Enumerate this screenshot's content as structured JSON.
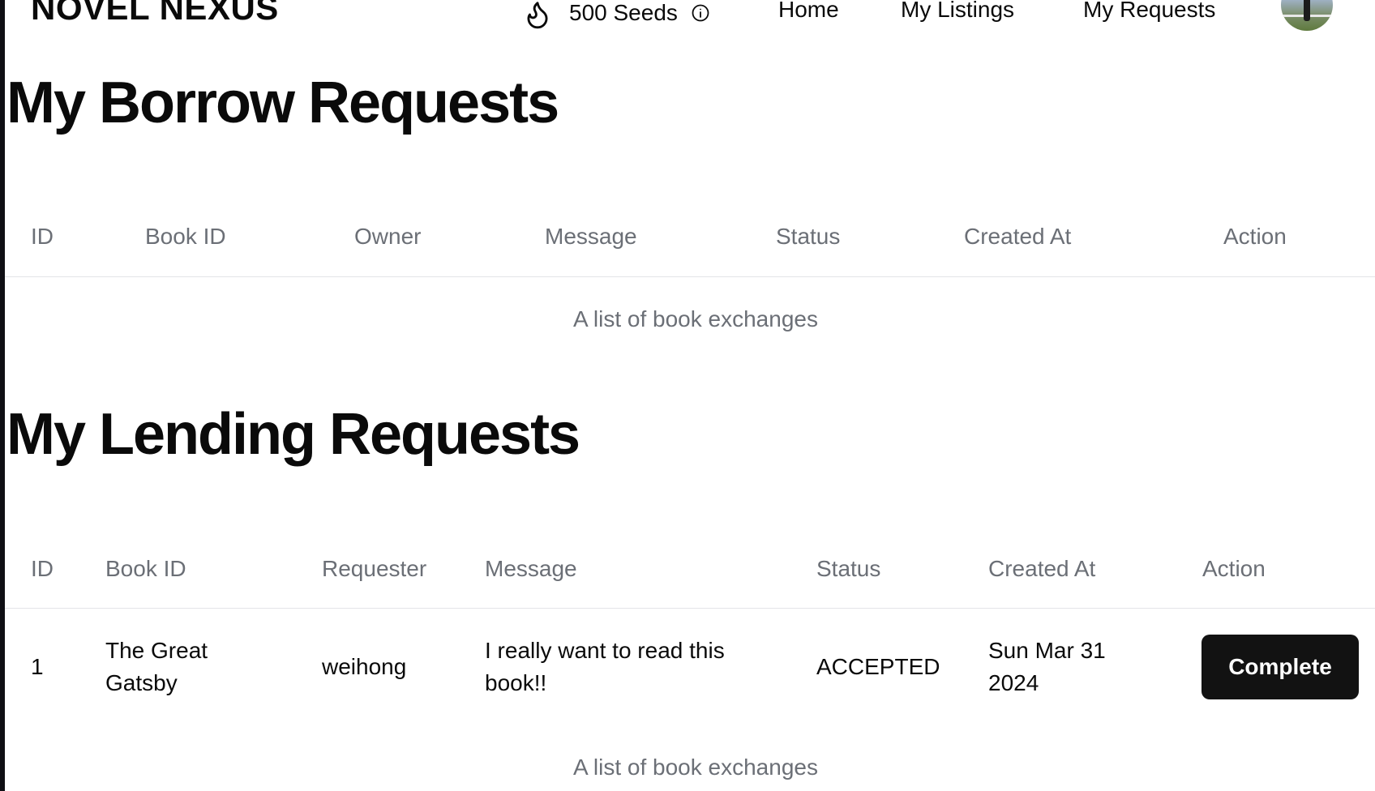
{
  "header": {
    "brand": "NOVEL NEXUS",
    "seeds_label": "500 Seeds",
    "nav": {
      "home": "Home",
      "my_listings": "My Listings",
      "my_requests": "My Requests"
    }
  },
  "borrow": {
    "title": "My Borrow Requests",
    "columns": {
      "id": "ID",
      "book_id": "Book ID",
      "owner": "Owner",
      "message": "Message",
      "status": "Status",
      "created_at": "Created At",
      "action": "Action"
    },
    "caption": "A list of book exchanges"
  },
  "lending": {
    "title": "My Lending Requests",
    "columns": {
      "id": "ID",
      "book_id": "Book ID",
      "requester": "Requester",
      "message": "Message",
      "status": "Status",
      "created_at": "Created At",
      "action": "Action"
    },
    "rows": [
      {
        "id": "1",
        "book_line1": "The Great",
        "book_line2": "Gatsby",
        "requester": "weihong",
        "message_line1": "I really want to read this",
        "message_line2": "book!!",
        "status": "ACCEPTED",
        "created_line1": "Sun Mar 31",
        "created_line2": "2024",
        "action": "Complete"
      }
    ],
    "caption": "A list of book exchanges"
  },
  "colors": {
    "primary_button": "#121212",
    "muted_text": "#6b6f76",
    "border": "#e3e4e8"
  },
  "icons": {
    "seeds": "flame-icon",
    "info": "info-icon"
  }
}
